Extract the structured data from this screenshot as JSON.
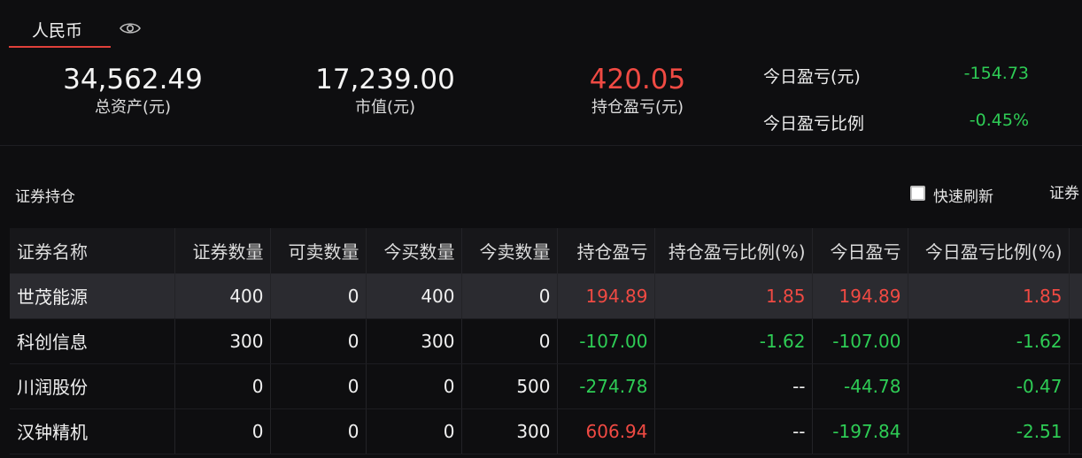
{
  "header": {
    "currency_tab": "人民币",
    "visibility_icon": "eye-icon"
  },
  "summary": {
    "total_assets": {
      "value": "34,562.49",
      "label": "总资产(元)"
    },
    "market_value": {
      "value": "17,239.00",
      "label": "市值(元)"
    },
    "position_pnl": {
      "value": "420.05",
      "label": "持仓盈亏(元)"
    },
    "today_pnl": {
      "label": "今日盈亏(元)",
      "value": "-154.73"
    },
    "today_pnl_ratio": {
      "label": "今日盈亏比例",
      "value": "-0.45%"
    }
  },
  "section": {
    "title": "证券持仓",
    "quick_refresh_label": "快速刷新",
    "quick_refresh_checked": false,
    "truncated_right_text": "证券"
  },
  "colors": {
    "accent_red": "#f04a43",
    "gain_green": "#2ecc55",
    "tab_underline": "#e0403a"
  },
  "table": {
    "columns": [
      "证券名称",
      "证券数量",
      "可卖数量",
      "今买数量",
      "今卖数量",
      "持仓盈亏",
      "持仓盈亏比例(%)",
      "今日盈亏",
      "今日盈亏比例(%)"
    ],
    "rows": [
      [
        "世茂能源",
        "400",
        "0",
        "400",
        "0",
        "194.89",
        "1.85",
        "194.89",
        "1.85"
      ],
      [
        "科创信息",
        "300",
        "0",
        "300",
        "0",
        "-107.00",
        "-1.62",
        "-107.00",
        "-1.62"
      ],
      [
        "川润股份",
        "0",
        "0",
        "0",
        "500",
        "-274.78",
        "--",
        "-44.78",
        "-0.47"
      ],
      [
        "汉钟精机",
        "0",
        "0",
        "0",
        "300",
        "606.94",
        "--",
        "-197.84",
        "-2.51"
      ]
    ],
    "selected_row": 0
  }
}
